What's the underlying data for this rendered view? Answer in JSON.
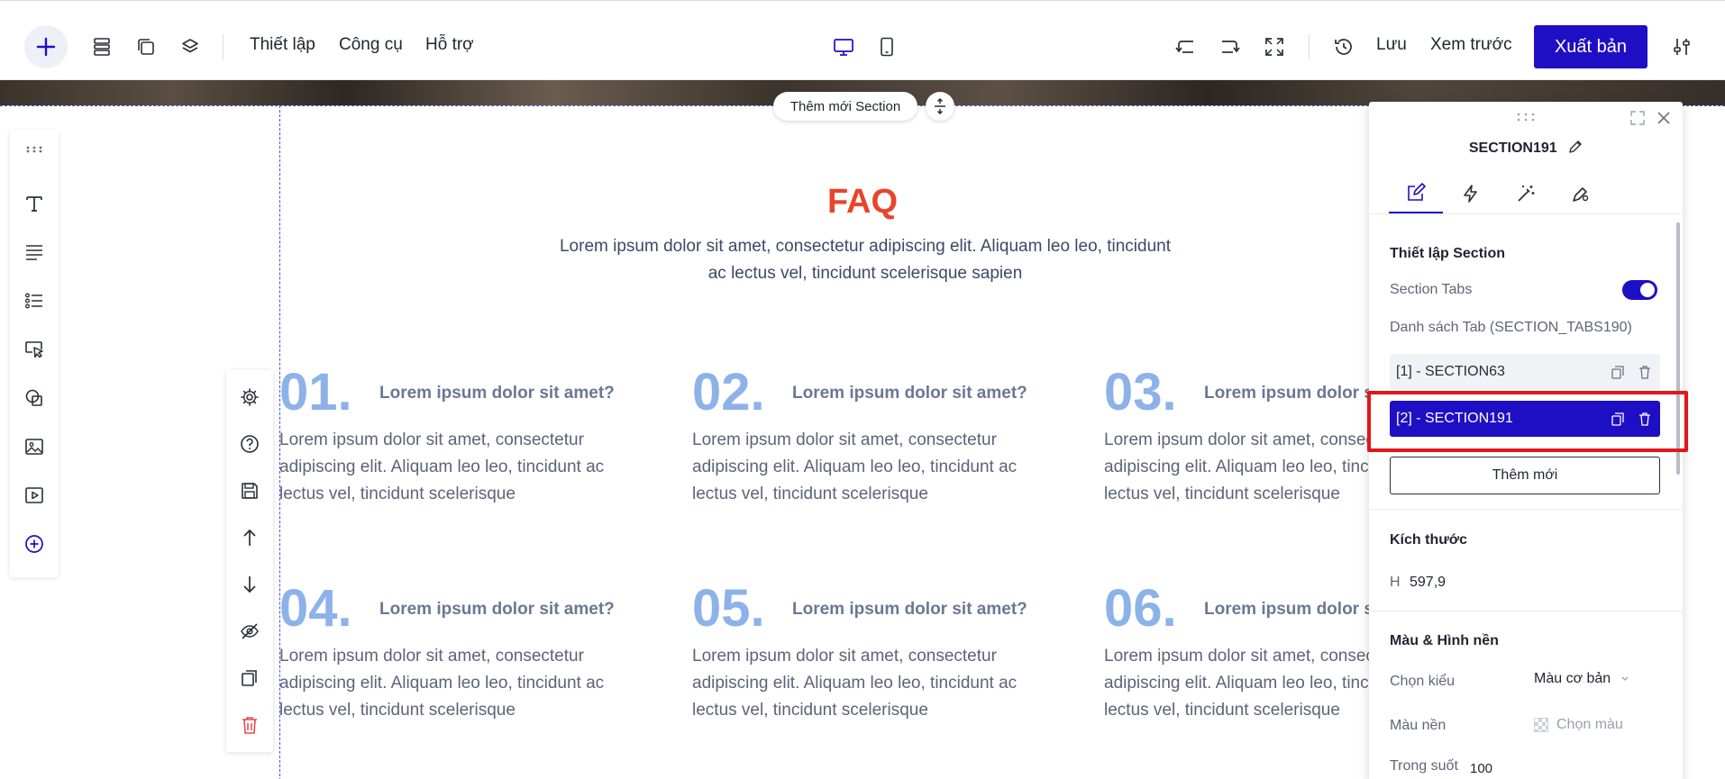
{
  "topbar": {
    "menu": [
      "Thiết lập",
      "Công cụ",
      "Hỗ trợ"
    ],
    "save_label": "Lưu",
    "preview_label": "Xem trước",
    "publish_label": "Xuất bản"
  },
  "canvas": {
    "add_section_label": "Thêm mới Section",
    "faq": {
      "title": "FAQ",
      "subtitle": "Lorem ipsum dolor sit amet, consectetur adipiscing elit. Aliquam leo leo, tincidunt ac lectus vel, tincidunt scelerisque sapien",
      "items": [
        {
          "num": "01.",
          "question": "Lorem ipsum dolor sit amet?",
          "answer": "Lorem ipsum dolor sit amet, consectetur adipiscing elit. Aliquam leo leo, tincidunt ac lectus vel, tincidunt scelerisque"
        },
        {
          "num": "02.",
          "question": "Lorem ipsum dolor sit amet?",
          "answer": "Lorem ipsum dolor sit amet, consectetur adipiscing elit. Aliquam leo leo, tincidunt ac lectus vel, tincidunt scelerisque"
        },
        {
          "num": "03.",
          "question": "Lorem ipsum dolor sit amet?",
          "answer": "Lorem ipsum dolor sit amet, consectetur adipiscing elit. Aliquam leo leo, tincidunt ac lectus vel, tincidunt scelerisque"
        },
        {
          "num": "04.",
          "question": "Lorem ipsum dolor sit amet?",
          "answer": "Lorem ipsum dolor sit amet, consectetur adipiscing elit. Aliquam leo leo, tincidunt ac lectus vel, tincidunt scelerisque"
        },
        {
          "num": "05.",
          "question": "Lorem ipsum dolor sit amet?",
          "answer": "Lorem ipsum dolor sit amet, consectetur adipiscing elit. Aliquam leo leo, tincidunt ac lectus vel, tincidunt scelerisque"
        },
        {
          "num": "06.",
          "question": "Lorem ipsum dolor sit amet?",
          "answer": "Lorem ipsum dolor sit amet, consectetur adipiscing elit. Aliquam leo leo, tincidunt ac lectus vel, tincidunt scelerisque"
        }
      ]
    }
  },
  "panel": {
    "title": "SECTION191",
    "settings_heading": "Thiết lập Section",
    "section_tabs_label": "Section Tabs",
    "section_tabs_enabled": true,
    "tab_list_label": "Danh sách Tab (SECTION_TABS190)",
    "tabs": [
      {
        "label": "[1] - SECTION63",
        "active": false
      },
      {
        "label": "[2] - SECTION191",
        "active": true
      }
    ],
    "add_new_label": "Thêm mới",
    "size_heading": "Kích thước",
    "height_label": "H",
    "height_value": "597,9",
    "background_heading": "Màu & Hình nền",
    "style_label": "Chọn kiểu",
    "style_value": "Màu cơ bản",
    "bg_color_label": "Màu nền",
    "bg_color_placeholder": "Chọn màu",
    "opacity_label": "Trong suốt",
    "opacity_value": "100"
  },
  "colors": {
    "accent": "#1f0fc4",
    "faq_title": "#e8452c",
    "faq_number": "#8db2ea",
    "highlight": "#e3161b",
    "delete": "#e5484d"
  }
}
